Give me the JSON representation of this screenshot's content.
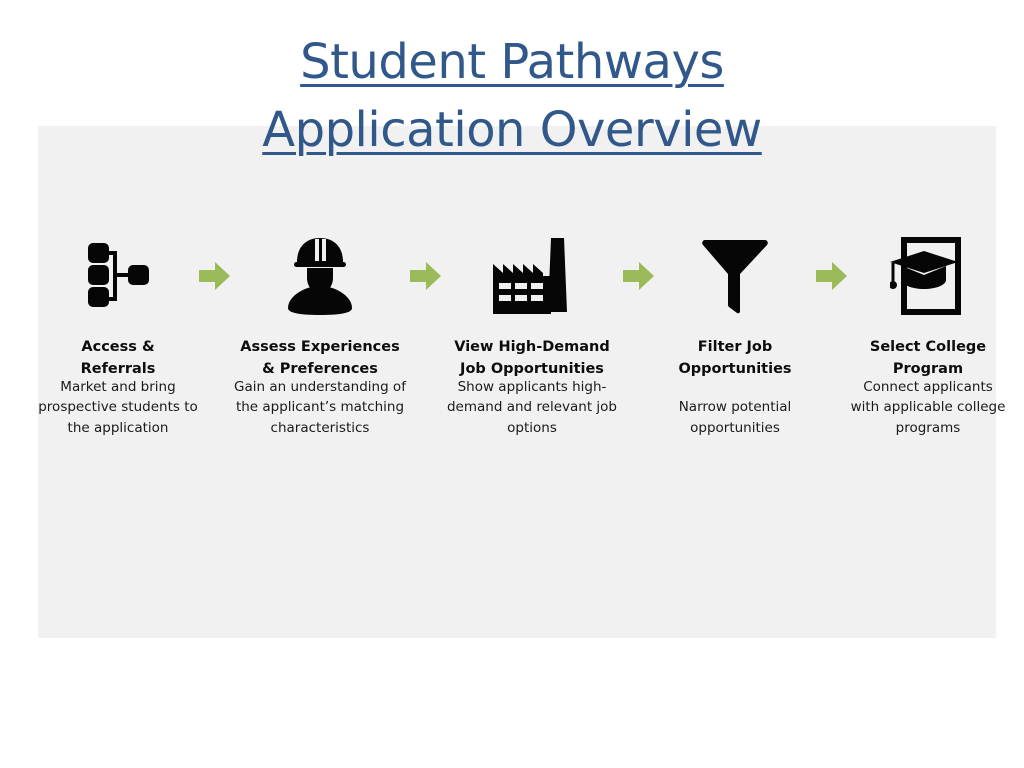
{
  "slide": {
    "title": "Student Pathways Application Overview",
    "title_color": "#31588a",
    "panel_color": "#f1f1f1",
    "background_color": "#ffffff",
    "arrow_color": "#9bba5a",
    "icon_color": "#060606"
  },
  "steps": [
    {
      "index": 1,
      "icon": "org-chart-icon",
      "heading": "Access &\nReferrals",
      "description": "Market and bring prospective students to the application"
    },
    {
      "index": 2,
      "icon": "hardhat-worker-icon",
      "heading": "Assess Experiences\n& Preferences",
      "description": "Gain an understanding of the applicant’s matching characteristics"
    },
    {
      "index": 3,
      "icon": "factory-icon",
      "heading": "View High-Demand\nJob Opportunities",
      "description": "Show applicants high-demand and relevant job options"
    },
    {
      "index": 4,
      "icon": "funnel-filter-icon",
      "heading": "Filter Job\nOpportunities",
      "description": "Narrow potential opportunities"
    },
    {
      "index": 5,
      "icon": "graduation-document-icon",
      "heading": "Select College\nProgram",
      "description": "Connect applicants with applicable college programs"
    }
  ],
  "connectors": [
    {
      "index": 1,
      "icon": "right-arrow-icon"
    },
    {
      "index": 2,
      "icon": "right-arrow-icon"
    },
    {
      "index": 3,
      "icon": "right-arrow-icon"
    },
    {
      "index": 4,
      "icon": "right-arrow-icon"
    }
  ]
}
